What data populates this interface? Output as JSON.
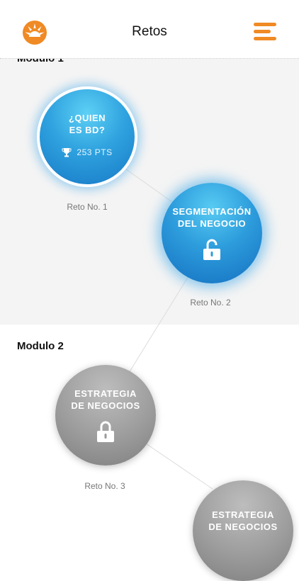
{
  "header": {
    "title": "Retos",
    "logo_icon": "sun-logo-icon",
    "menu_icon": "hamburger-menu-icon",
    "accent_color": "#f08a24"
  },
  "modules": [
    {
      "label": "Modulo 1"
    },
    {
      "label": "Modulo 2"
    }
  ],
  "challenges": [
    {
      "title_line1": "¿QUIEN",
      "title_line2": "ES BD?",
      "points": "253 PTS",
      "label": "Reto No. 1",
      "status": "completed",
      "icon": "trophy-icon"
    },
    {
      "title_line1": "SEGMENTACIÓN",
      "title_line2": "DEL NEGOCIO",
      "label": "Reto No. 2",
      "status": "unlocked",
      "icon": "unlocked-padlock-icon"
    },
    {
      "title_line1": "ESTRATEGIA",
      "title_line2": "DE NEGOCIOS",
      "label": "Reto No. 3",
      "status": "locked",
      "icon": "locked-padlock-icon"
    },
    {
      "title_line1": "ESTRATEGIA",
      "title_line2": "DE NEGOCIOS",
      "status": "locked"
    }
  ]
}
